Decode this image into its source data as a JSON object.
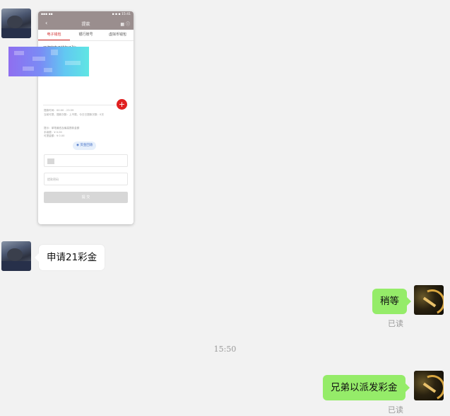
{
  "messages": [
    {
      "sender": "user",
      "type": "image",
      "screenshot": {
        "status_left": "▪▪▪ ▪▪",
        "status_right": "▪ ▪ ▪ 15:41",
        "title": "提款",
        "tabs": [
          "电子钱包",
          "银行账号",
          "虚拟币钱包"
        ],
        "active_tab": 0,
        "bound_label": "已绑定电子钱包(1张)",
        "add_icon": "plus-icon",
        "info_lines_1": [
          "提款时间：00:00 - 23:59",
          "当前可提，提款次数：上不限，今日已提款次数：0次"
        ],
        "info_lines_2": [
          "提示：单笔最低及最高提款金额",
          "手续费：¥ 0.00",
          "可提金额：¥ 0.00"
        ],
        "badge": "资金回收",
        "password_placeholder": "提款密码",
        "submit_label": "提 交"
      }
    },
    {
      "sender": "user",
      "type": "text",
      "text": "申请21彩金"
    },
    {
      "sender": "me",
      "type": "text",
      "text": "稍等",
      "status": "已读"
    },
    {
      "type": "time",
      "text": "15:50"
    },
    {
      "sender": "me",
      "type": "text",
      "text": "兄弟以派发彩金",
      "status": "已读"
    }
  ],
  "colors": {
    "self_bubble": "#95ec69",
    "accent_red": "#e02020"
  }
}
